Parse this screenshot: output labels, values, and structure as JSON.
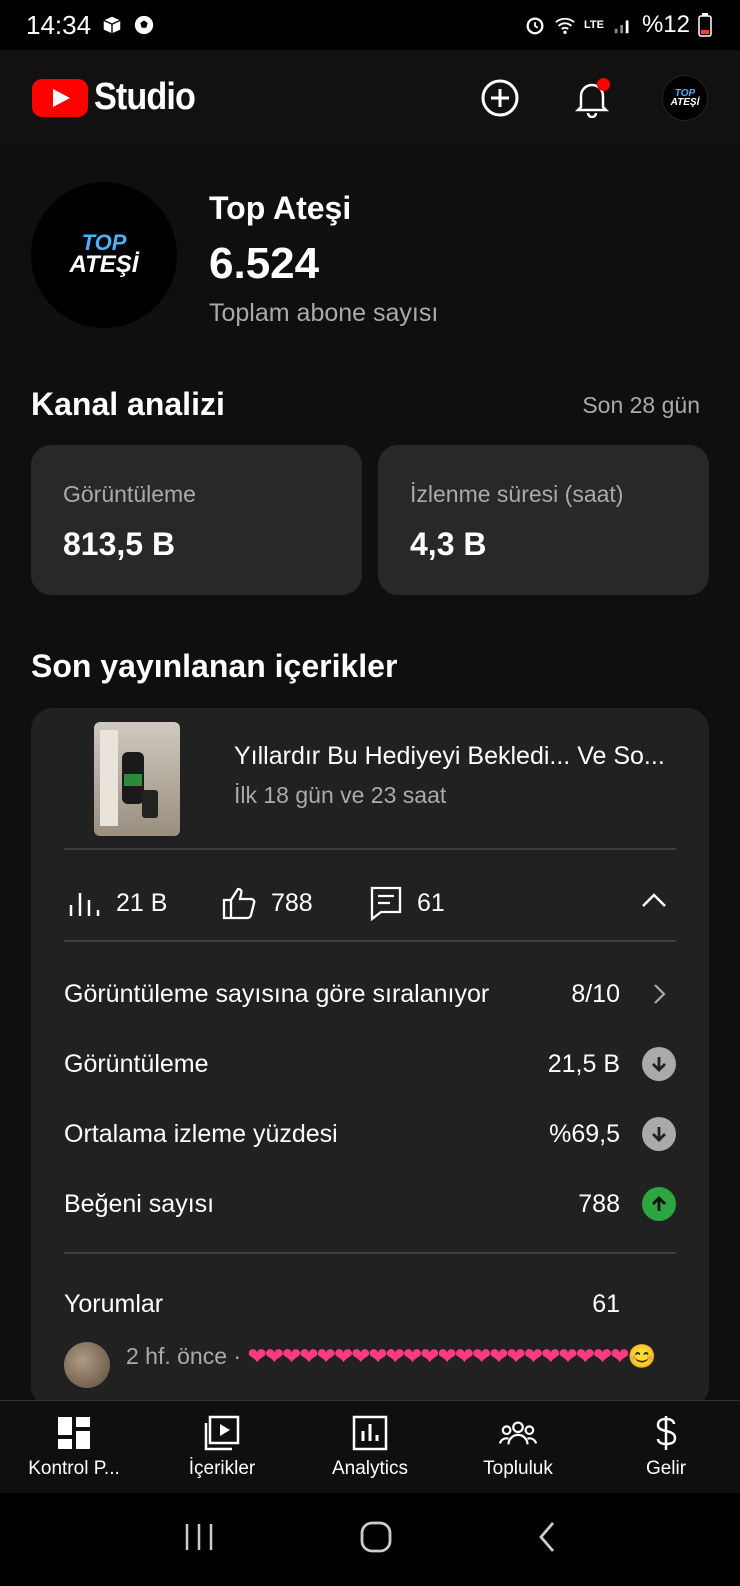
{
  "status_bar": {
    "time": "14:34",
    "battery": "%12",
    "network": "LTE"
  },
  "header": {
    "brand": "Studio"
  },
  "channel": {
    "name": "Top Ateşi",
    "logo_line1": "TOP",
    "logo_line2": "ATEŞİ",
    "subscribers": "6.524",
    "subscribers_label": "Toplam abone sayısı"
  },
  "analytics": {
    "title": "Kanal analizi",
    "period": "Son 28 gün",
    "cards": [
      {
        "label": "Görüntüleme",
        "value": "813,5 B"
      },
      {
        "label": "İzlenme süresi (saat)",
        "value": "4,3 B"
      }
    ]
  },
  "recent": {
    "title": "Son yayınlanan içerikler",
    "video": {
      "title": "Yıllardır Bu Hediyeyi Bekledi... Ve So...",
      "age": "İlk 18 gün ve 23 saat"
    },
    "metrics": {
      "views": "21 B",
      "likes": "788",
      "comments": "61"
    },
    "rows": [
      {
        "label": "Görüntüleme sayısına göre sıralanıyor",
        "value": "8/10",
        "indicator": "chevron-right"
      },
      {
        "label": "Görüntüleme",
        "value": "21,5 B",
        "indicator": "down"
      },
      {
        "label": "Ortalama izleme yüzdesi",
        "value": "%69,5",
        "indicator": "down"
      },
      {
        "label": "Beğeni sayısı",
        "value": "788",
        "indicator": "up"
      }
    ],
    "comments_label": "Yorumlar",
    "comments_count": "61",
    "comment": {
      "time": "2 hf. önce ·",
      "text": "❤❤❤❤❤❤❤❤❤❤❤❤❤❤❤❤❤❤❤❤❤❤😊"
    }
  },
  "bottom_nav": [
    {
      "label": "Kontrol P...",
      "icon": "dashboard-icon"
    },
    {
      "label": "İçerikler",
      "icon": "content-icon"
    },
    {
      "label": "Analytics",
      "icon": "analytics-icon"
    },
    {
      "label": "Topluluk",
      "icon": "community-icon"
    },
    {
      "label": "Gelir",
      "icon": "earn-icon"
    }
  ],
  "colors": {
    "background": "#0f0f0f",
    "card": "#282828",
    "accent_red": "#ff0000",
    "trend_up": "#2ba640",
    "trend_down": "#aaaaaa"
  }
}
